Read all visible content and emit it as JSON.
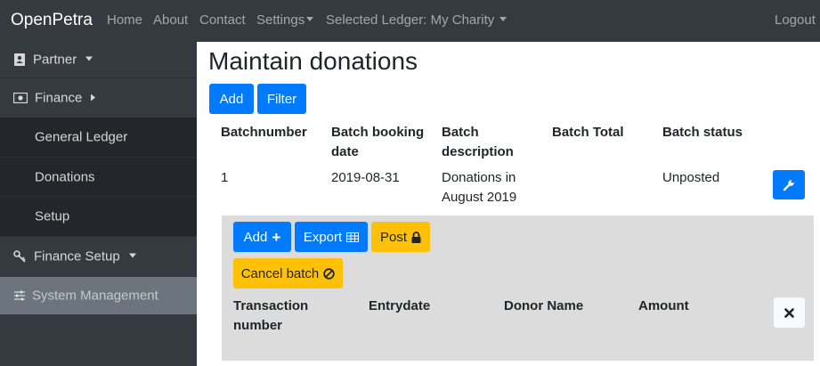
{
  "navbar": {
    "brand": "OpenPetra",
    "links": [
      "Home",
      "About",
      "Contact"
    ],
    "settings": "Settings",
    "ledger": "Selected Ledger: My Charity",
    "logout": "Logout"
  },
  "sidebar": {
    "partner": "Partner",
    "finance": "Finance",
    "general_ledger": "General Ledger",
    "donations": "Donations",
    "setup": "Setup",
    "finance_setup": "Finance Setup",
    "system_management": "System Management"
  },
  "main": {
    "title": "Maintain donations",
    "add": "Add",
    "filter": "Filter",
    "columns": [
      "Batchnumber",
      "Batch booking date",
      "Batch description",
      "Batch Total",
      "Batch status"
    ],
    "rows": [
      {
        "number": "1",
        "date": "2019-08-31",
        "description": "Donations in August 2019",
        "total": "",
        "status": "Unposted"
      }
    ],
    "detail": {
      "add": "Add",
      "export": "Export",
      "post": "Post",
      "cancel": "Cancel batch",
      "columns": [
        "Transaction number",
        "Entrydate",
        "Donor Name",
        "Amount"
      ]
    }
  },
  "colors": {
    "primary": "#007bff",
    "warning": "#ffc107",
    "navbar": "#343a40"
  }
}
